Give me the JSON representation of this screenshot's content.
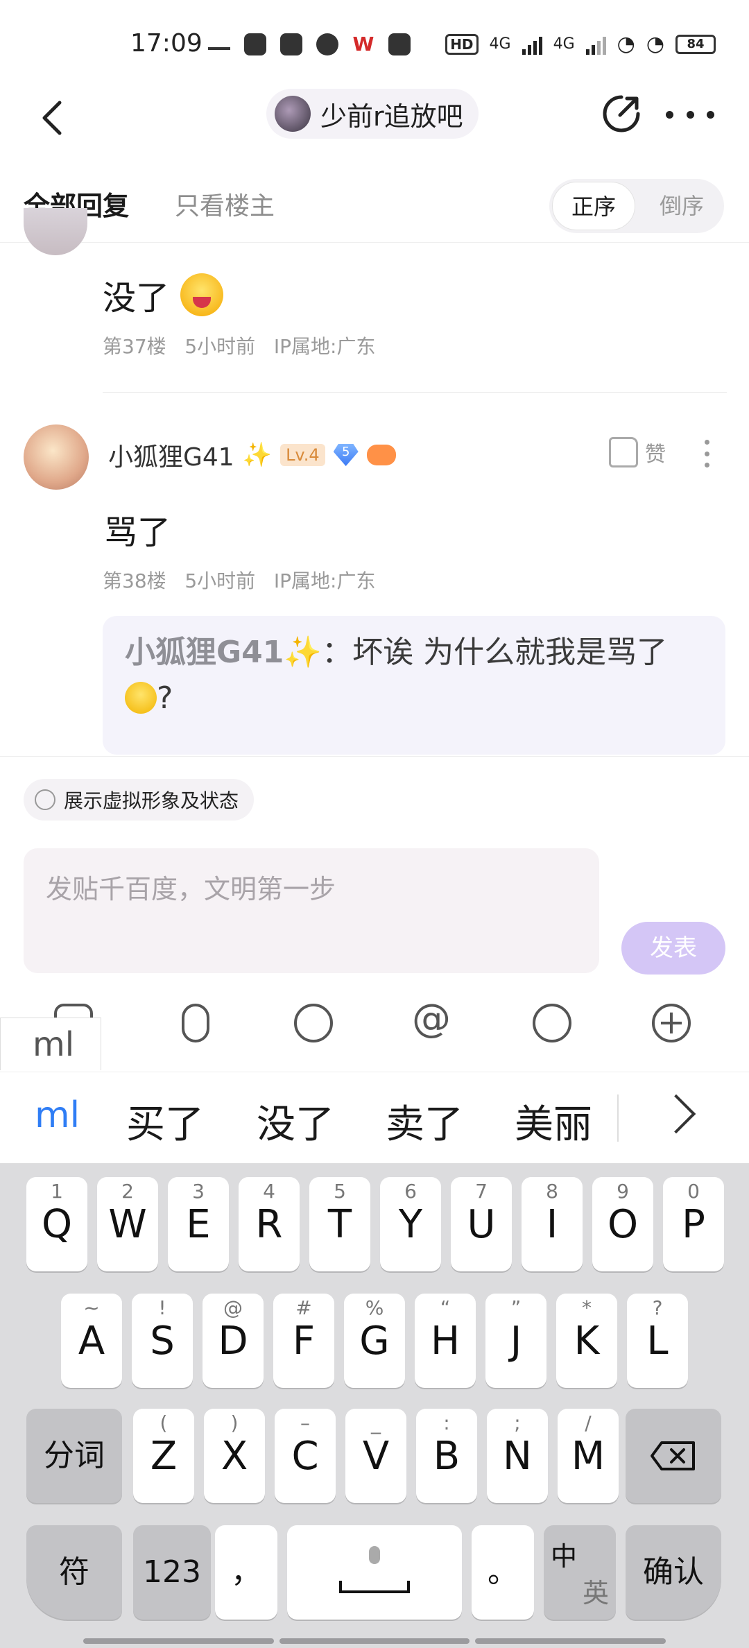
{
  "status_bar": {
    "time": "17:09",
    "network": "4G",
    "network2": "4G",
    "battery": "84"
  },
  "nav": {
    "forum_name": "少前r追放吧"
  },
  "tabs": {
    "all": "全部回复",
    "op_only": "只看楼主",
    "order_asc": "正序",
    "order_desc": "倒序"
  },
  "posts": [
    {
      "text": "没了",
      "floor": "第37楼",
      "time": "5小时前",
      "ip": "IP属地:广东"
    },
    {
      "user": "小狐狸G41",
      "sparkle": "✨",
      "level": "Lv.4",
      "diamond_level": "5",
      "like_label": "赞",
      "text": "骂了",
      "floor": "第38楼",
      "time": "5小时前",
      "ip": "IP属地:广东",
      "quote": {
        "name": "小狐狸G41✨",
        "separator": "：",
        "text": "坏诶 为什么就我是骂了",
        "tail": "?"
      }
    }
  ],
  "composer": {
    "avatar_toggle": "展示虚拟形象及状态",
    "placeholder": "发贴千百度，文明第一步",
    "send": "发表",
    "float_input": "ml"
  },
  "ime": {
    "composition": "ml",
    "candidates": [
      "买了",
      "没了",
      "卖了",
      "美丽"
    ],
    "row1": [
      {
        "k": "Q",
        "s": "1"
      },
      {
        "k": "W",
        "s": "2"
      },
      {
        "k": "E",
        "s": "3"
      },
      {
        "k": "R",
        "s": "4"
      },
      {
        "k": "T",
        "s": "5"
      },
      {
        "k": "Y",
        "s": "6"
      },
      {
        "k": "U",
        "s": "7"
      },
      {
        "k": "I",
        "s": "8"
      },
      {
        "k": "O",
        "s": "9"
      },
      {
        "k": "P",
        "s": "0"
      }
    ],
    "row2": [
      {
        "k": "A",
        "s": "~"
      },
      {
        "k": "S",
        "s": "!"
      },
      {
        "k": "D",
        "s": "@"
      },
      {
        "k": "F",
        "s": "#"
      },
      {
        "k": "G",
        "s": "%"
      },
      {
        "k": "H",
        "s": "“"
      },
      {
        "k": "J",
        "s": "”"
      },
      {
        "k": "K",
        "s": "*"
      },
      {
        "k": "L",
        "s": "?"
      }
    ],
    "row3": [
      {
        "k": "Z",
        "s": "("
      },
      {
        "k": "X",
        "s": ")"
      },
      {
        "k": "C",
        "s": "–"
      },
      {
        "k": "V",
        "s": "_"
      },
      {
        "k": "B",
        "s": ":"
      },
      {
        "k": "N",
        "s": ";"
      },
      {
        "k": "M",
        "s": "/"
      }
    ],
    "segment_key": "分词",
    "symbol_key": "符",
    "num_key": "123",
    "comma_key": "，",
    "period_key": "。",
    "lang_key_top": "中",
    "lang_key_bottom": "英",
    "confirm_key": "确认"
  }
}
